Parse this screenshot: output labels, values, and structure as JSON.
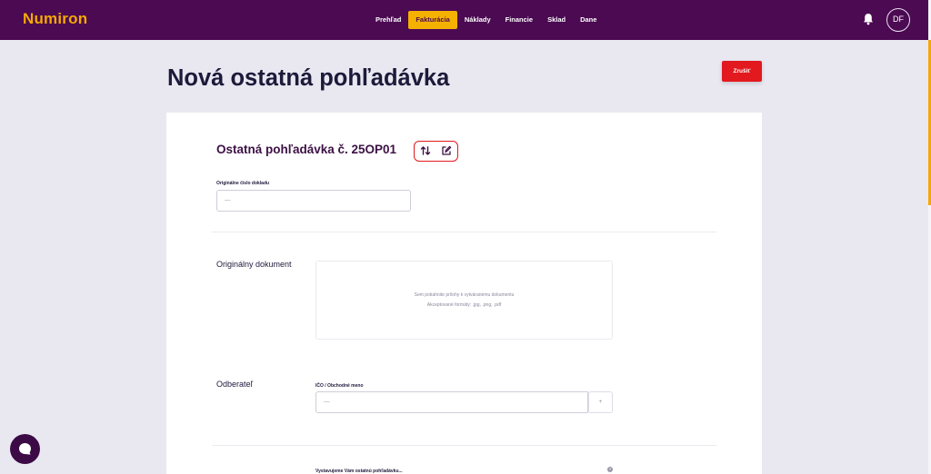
{
  "app": {
    "logo": "Numiron"
  },
  "nav": {
    "items": [
      {
        "label": "Prehľad",
        "active": false
      },
      {
        "label": "Fakturácia",
        "active": true
      },
      {
        "label": "Náklady",
        "active": false
      },
      {
        "label": "Financie",
        "active": false
      },
      {
        "label": "Sklad",
        "active": false
      },
      {
        "label": "Dane",
        "active": false
      }
    ]
  },
  "user": {
    "initials": "DF"
  },
  "page": {
    "title": "Nová ostatná pohľadávka",
    "cancel_label": "Zrušiť"
  },
  "document": {
    "title": "Ostatná pohľadávka č. 25OP01",
    "original_number_label": "Originálne číslo dokladu",
    "original_number_placeholder": "----"
  },
  "original_document": {
    "section_label": "Originálny dokument",
    "dropzone_line1": "Sem potiahnite prílohy k vytváranému dokumentu",
    "dropzone_line2": "Akceptované formáty: .jpg, .png, .pdf"
  },
  "customer": {
    "section_label": "Odberateľ",
    "field_label": "IČO / Obchodné meno",
    "field_placeholder": "----",
    "add_label": "+"
  },
  "issuing": {
    "label": "Vystavujeme Vám ostatnú pohľadávku..."
  },
  "colors": {
    "topbar": "#4b0a52",
    "accent": "#f5a900",
    "danger": "#e2191e",
    "background": "#e9e8f1"
  }
}
